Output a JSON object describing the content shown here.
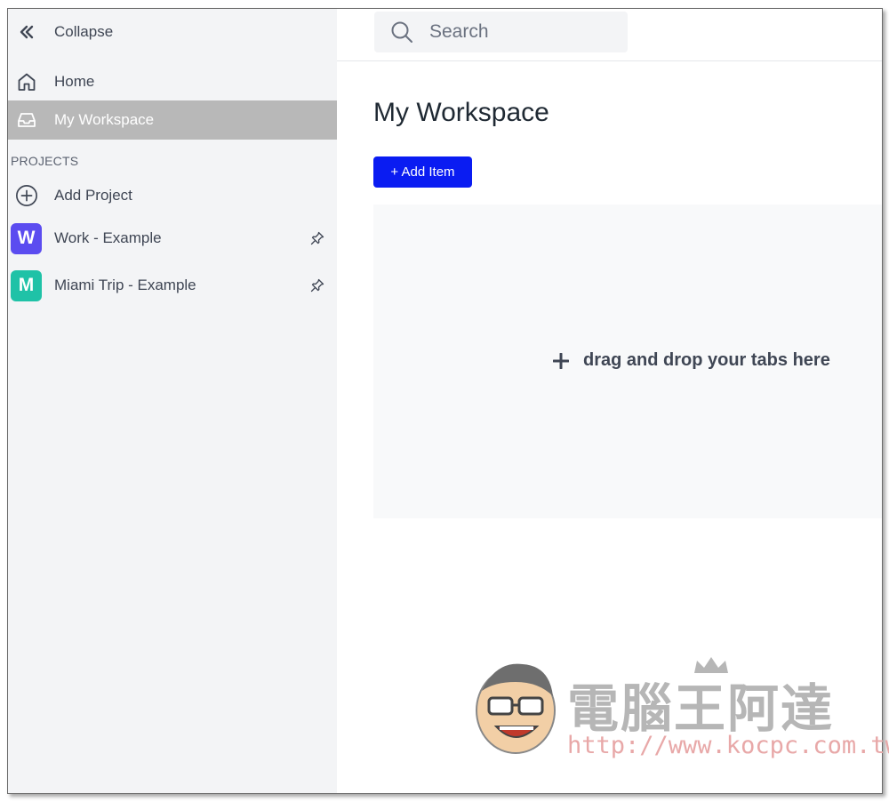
{
  "sidebar": {
    "collapse_label": "Collapse",
    "home_label": "Home",
    "workspace_label": "My Workspace",
    "projects_heading": "PROJECTS",
    "add_project_label": "Add Project",
    "projects": [
      {
        "initial": "W",
        "name": "Work - Example",
        "color": "#5b4cf0"
      },
      {
        "initial": "M",
        "name": "Miami Trip - Example",
        "color": "#1fc2a7"
      }
    ]
  },
  "header": {
    "search_placeholder": "Search"
  },
  "main": {
    "title": "My Workspace",
    "add_item_label": "+ Add Item",
    "drop_text": "drag and drop your tabs here"
  },
  "watermark": {
    "title": "電腦王阿達",
    "url": "http://www.kocpc.com.tw"
  },
  "colors": {
    "accent": "#0a1cf2",
    "active_item_bg": "#b8b8b8"
  }
}
